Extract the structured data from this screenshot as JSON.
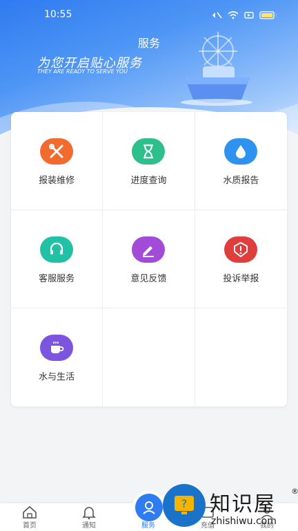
{
  "status_bar": {
    "time": "10:55"
  },
  "header": {
    "title": "服务",
    "slogan": "为您开启贴心服务",
    "slogan_en": "THEY ARE READY TO SERVE YOU"
  },
  "services": [
    {
      "label": "报装维修",
      "icon": "wrench-screwdriver-icon",
      "color": "#f26b2e"
    },
    {
      "label": "进度查询",
      "icon": "hourglass-icon",
      "color": "#2dc08d"
    },
    {
      "label": "水质报告",
      "icon": "water-drop-icon",
      "color": "#2e93ee"
    },
    {
      "label": "客服服务",
      "icon": "headset-icon",
      "color": "#22c1a6"
    },
    {
      "label": "意见反馈",
      "icon": "pencil-icon",
      "color": "#a24bd8"
    },
    {
      "label": "投诉举报",
      "icon": "alert-icon",
      "color": "#e03d3d"
    },
    {
      "label": "水与生活",
      "icon": "cup-icon",
      "color": "#7b55e0"
    }
  ],
  "tabbar": {
    "items": [
      {
        "label": "首页",
        "icon": "home-icon"
      },
      {
        "label": "通知",
        "icon": "bell-icon"
      },
      {
        "label": "服务",
        "icon": "service-icon",
        "active": true
      },
      {
        "label": "充值",
        "icon": "recharge-icon"
      },
      {
        "label": "我的",
        "icon": "profile-icon"
      }
    ]
  },
  "watermark": {
    "brand": "知识屋",
    "url": "zhishiwu.com",
    "reg": "®"
  },
  "colors": {
    "primary": "#2f7bf0",
    "background": "#f3f4f6"
  }
}
